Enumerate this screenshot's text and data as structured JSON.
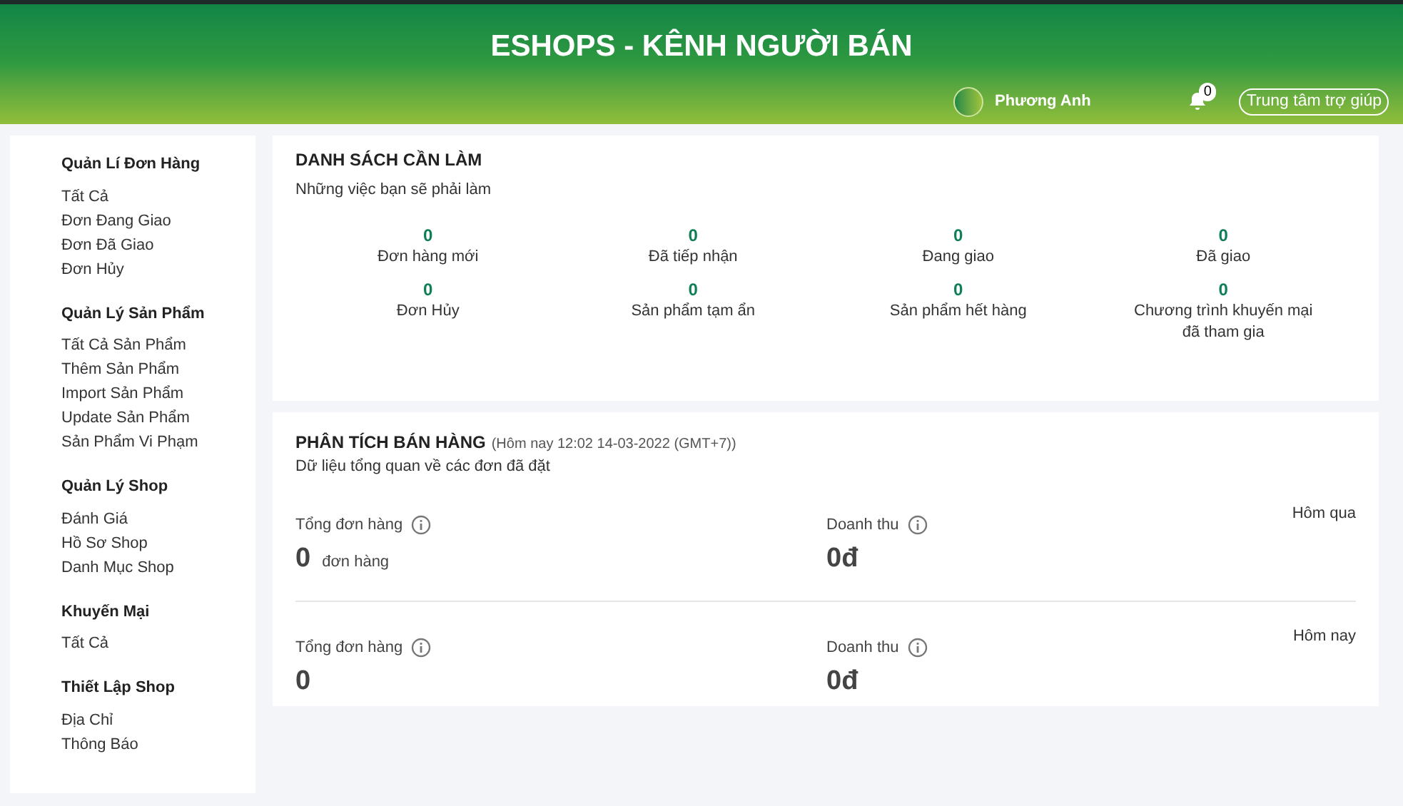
{
  "header": {
    "title": "ESHOPS - KÊNH NGƯỜI BÁN",
    "user_name": "Phương Anh",
    "notification_count": "0",
    "help_button": "Trung tâm trợ giúp"
  },
  "sidebar": {
    "groups": [
      {
        "title": "Quản Lí Đơn Hàng",
        "items": [
          "Tất Cả",
          "Đơn Đang Giao",
          "Đơn Đã Giao",
          "Đơn Hủy"
        ]
      },
      {
        "title": "Quản Lý Sản Phẩm",
        "items": [
          "Tất Cả Sản Phẩm",
          "Thêm Sản Phẩm",
          "Import Sản Phẩm",
          "Update Sản Phẩm",
          "Sản Phẩm Vi Phạm"
        ]
      },
      {
        "title": "Quản Lý Shop",
        "items": [
          "Đánh Giá",
          "Hồ Sơ Shop",
          "Danh Mục Shop"
        ]
      },
      {
        "title": "Khuyến Mại",
        "items": [
          "Tất Cả"
        ]
      },
      {
        "title": "Thiết Lập Shop",
        "items": [
          "Địa Chỉ",
          "Thông Báo"
        ]
      }
    ]
  },
  "todo": {
    "title": "DANH SÁCH CẦN LÀM",
    "subtitle": "Những việc bạn sẽ phải làm",
    "stats": [
      {
        "value": "0",
        "label": "Đơn hàng mới"
      },
      {
        "value": "0",
        "label": "Đã tiếp nhận"
      },
      {
        "value": "0",
        "label": "Đang giao"
      },
      {
        "value": "0",
        "label": "Đã giao"
      },
      {
        "value": "0",
        "label": "Đơn Hủy"
      },
      {
        "value": "0",
        "label": "Sản phẩm tạm ẩn"
      },
      {
        "value": "0",
        "label": "Sản phẩm hết hàng"
      },
      {
        "value": "0",
        "label": "Chương trình khuyến mại đã tham gia"
      }
    ]
  },
  "analysis": {
    "title": "PHÂN TÍCH BÁN HÀNG",
    "timestamp": "(Hôm nay 12:02 14-03-2022 (GMT+7))",
    "subtitle": "Dữ liệu tổng quan về các đơn đã đặt",
    "periods": [
      {
        "period": "Hôm qua",
        "orders_label": "Tổng đơn hàng",
        "orders_value": "0",
        "orders_unit": "đơn hàng",
        "revenue_label": "Doanh thu",
        "revenue_value": "0đ"
      },
      {
        "period": "Hôm nay",
        "orders_label": "Tổng đơn hàng",
        "orders_value": "0",
        "revenue_label": "Doanh thu",
        "revenue_value": "0đ"
      }
    ]
  }
}
